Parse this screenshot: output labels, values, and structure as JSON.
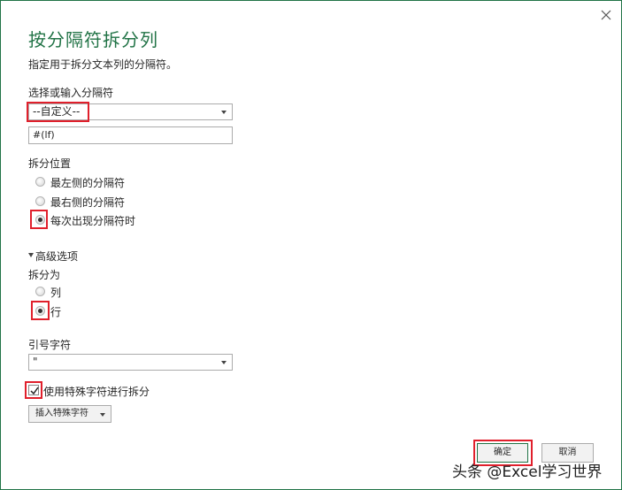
{
  "dialog": {
    "title": "按分隔符拆分列",
    "subtitle": "指定用于拆分文本列的分隔符。",
    "close_label": "×"
  },
  "delimiter": {
    "label": "选择或输入分隔符",
    "selected": "--自定义--",
    "custom_value": "#(lf)"
  },
  "split_at": {
    "label": "拆分位置",
    "options": [
      "最左侧的分隔符",
      "最右侧的分隔符",
      "每次出现分隔符时"
    ],
    "selected_index": 2
  },
  "advanced": {
    "label": "高级选项",
    "split_into": {
      "label": "拆分为",
      "options": [
        "列",
        "行"
      ],
      "selected_index": 1
    },
    "quote": {
      "label": "引号字符",
      "selected": "\""
    },
    "special_chars": {
      "label": "使用特殊字符进行拆分",
      "checked": true,
      "insert_button": "插入特殊字符"
    }
  },
  "buttons": {
    "ok": "确定",
    "cancel": "取消"
  },
  "watermark": "头条 @Excel学习世界",
  "colors": {
    "accent": "#217346",
    "highlight": "#e0202c"
  }
}
